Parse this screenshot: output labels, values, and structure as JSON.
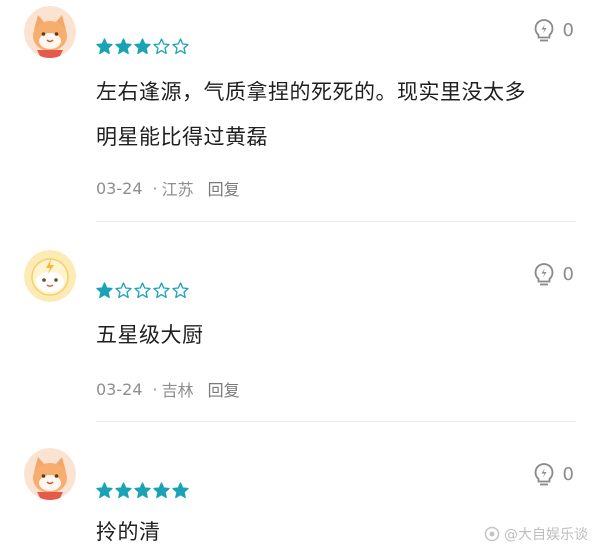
{
  "colors": {
    "star_filled": "#19a3b5",
    "star_empty": "#19a3b5",
    "meta_text": "#8e8e8e",
    "divider": "#ececec"
  },
  "comments": [
    {
      "avatar_icon": "cat-face-avatar-icon",
      "rating": 3,
      "like_count": "0",
      "text_lines": [
        "左右逢源，气质拿捏的死死的。现实里没太多",
        "明星能比得过黄磊"
      ],
      "date": "03-24",
      "location": "江苏",
      "reply_label": "回复"
    },
    {
      "avatar_icon": "sunny-face-avatar-icon",
      "rating": 1,
      "like_count": "0",
      "text_lines": [
        "五星级大厨"
      ],
      "date": "03-24",
      "location": "吉林",
      "reply_label": "回复"
    },
    {
      "avatar_icon": "cat-face-avatar-icon",
      "rating": 5,
      "like_count": "0",
      "text_lines": [
        "拎的清"
      ],
      "date": "",
      "location": "",
      "reply_label": ""
    }
  ],
  "watermark": {
    "text": "@大自娱乐谈"
  }
}
